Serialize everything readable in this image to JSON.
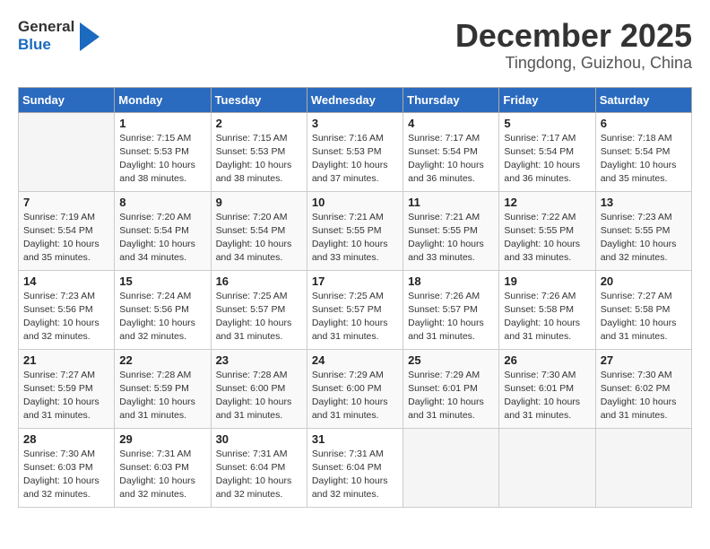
{
  "header": {
    "logo_line1": "General",
    "logo_line2": "Blue",
    "title": "December 2025",
    "subtitle": "Tingdong, Guizhou, China"
  },
  "calendar": {
    "weekdays": [
      "Sunday",
      "Monday",
      "Tuesday",
      "Wednesday",
      "Thursday",
      "Friday",
      "Saturday"
    ],
    "weeks": [
      [
        {
          "day": "",
          "sunrise": "",
          "sunset": "",
          "daylight": ""
        },
        {
          "day": "1",
          "sunrise": "Sunrise: 7:15 AM",
          "sunset": "Sunset: 5:53 PM",
          "daylight": "Daylight: 10 hours and 38 minutes."
        },
        {
          "day": "2",
          "sunrise": "Sunrise: 7:15 AM",
          "sunset": "Sunset: 5:53 PM",
          "daylight": "Daylight: 10 hours and 38 minutes."
        },
        {
          "day": "3",
          "sunrise": "Sunrise: 7:16 AM",
          "sunset": "Sunset: 5:53 PM",
          "daylight": "Daylight: 10 hours and 37 minutes."
        },
        {
          "day": "4",
          "sunrise": "Sunrise: 7:17 AM",
          "sunset": "Sunset: 5:54 PM",
          "daylight": "Daylight: 10 hours and 36 minutes."
        },
        {
          "day": "5",
          "sunrise": "Sunrise: 7:17 AM",
          "sunset": "Sunset: 5:54 PM",
          "daylight": "Daylight: 10 hours and 36 minutes."
        },
        {
          "day": "6",
          "sunrise": "Sunrise: 7:18 AM",
          "sunset": "Sunset: 5:54 PM",
          "daylight": "Daylight: 10 hours and 35 minutes."
        }
      ],
      [
        {
          "day": "7",
          "sunrise": "Sunrise: 7:19 AM",
          "sunset": "Sunset: 5:54 PM",
          "daylight": "Daylight: 10 hours and 35 minutes."
        },
        {
          "day": "8",
          "sunrise": "Sunrise: 7:20 AM",
          "sunset": "Sunset: 5:54 PM",
          "daylight": "Daylight: 10 hours and 34 minutes."
        },
        {
          "day": "9",
          "sunrise": "Sunrise: 7:20 AM",
          "sunset": "Sunset: 5:54 PM",
          "daylight": "Daylight: 10 hours and 34 minutes."
        },
        {
          "day": "10",
          "sunrise": "Sunrise: 7:21 AM",
          "sunset": "Sunset: 5:55 PM",
          "daylight": "Daylight: 10 hours and 33 minutes."
        },
        {
          "day": "11",
          "sunrise": "Sunrise: 7:21 AM",
          "sunset": "Sunset: 5:55 PM",
          "daylight": "Daylight: 10 hours and 33 minutes."
        },
        {
          "day": "12",
          "sunrise": "Sunrise: 7:22 AM",
          "sunset": "Sunset: 5:55 PM",
          "daylight": "Daylight: 10 hours and 33 minutes."
        },
        {
          "day": "13",
          "sunrise": "Sunrise: 7:23 AM",
          "sunset": "Sunset: 5:55 PM",
          "daylight": "Daylight: 10 hours and 32 minutes."
        }
      ],
      [
        {
          "day": "14",
          "sunrise": "Sunrise: 7:23 AM",
          "sunset": "Sunset: 5:56 PM",
          "daylight": "Daylight: 10 hours and 32 minutes."
        },
        {
          "day": "15",
          "sunrise": "Sunrise: 7:24 AM",
          "sunset": "Sunset: 5:56 PM",
          "daylight": "Daylight: 10 hours and 32 minutes."
        },
        {
          "day": "16",
          "sunrise": "Sunrise: 7:25 AM",
          "sunset": "Sunset: 5:57 PM",
          "daylight": "Daylight: 10 hours and 31 minutes."
        },
        {
          "day": "17",
          "sunrise": "Sunrise: 7:25 AM",
          "sunset": "Sunset: 5:57 PM",
          "daylight": "Daylight: 10 hours and 31 minutes."
        },
        {
          "day": "18",
          "sunrise": "Sunrise: 7:26 AM",
          "sunset": "Sunset: 5:57 PM",
          "daylight": "Daylight: 10 hours and 31 minutes."
        },
        {
          "day": "19",
          "sunrise": "Sunrise: 7:26 AM",
          "sunset": "Sunset: 5:58 PM",
          "daylight": "Daylight: 10 hours and 31 minutes."
        },
        {
          "day": "20",
          "sunrise": "Sunrise: 7:27 AM",
          "sunset": "Sunset: 5:58 PM",
          "daylight": "Daylight: 10 hours and 31 minutes."
        }
      ],
      [
        {
          "day": "21",
          "sunrise": "Sunrise: 7:27 AM",
          "sunset": "Sunset: 5:59 PM",
          "daylight": "Daylight: 10 hours and 31 minutes."
        },
        {
          "day": "22",
          "sunrise": "Sunrise: 7:28 AM",
          "sunset": "Sunset: 5:59 PM",
          "daylight": "Daylight: 10 hours and 31 minutes."
        },
        {
          "day": "23",
          "sunrise": "Sunrise: 7:28 AM",
          "sunset": "Sunset: 6:00 PM",
          "daylight": "Daylight: 10 hours and 31 minutes."
        },
        {
          "day": "24",
          "sunrise": "Sunrise: 7:29 AM",
          "sunset": "Sunset: 6:00 PM",
          "daylight": "Daylight: 10 hours and 31 minutes."
        },
        {
          "day": "25",
          "sunrise": "Sunrise: 7:29 AM",
          "sunset": "Sunset: 6:01 PM",
          "daylight": "Daylight: 10 hours and 31 minutes."
        },
        {
          "day": "26",
          "sunrise": "Sunrise: 7:30 AM",
          "sunset": "Sunset: 6:01 PM",
          "daylight": "Daylight: 10 hours and 31 minutes."
        },
        {
          "day": "27",
          "sunrise": "Sunrise: 7:30 AM",
          "sunset": "Sunset: 6:02 PM",
          "daylight": "Daylight: 10 hours and 31 minutes."
        }
      ],
      [
        {
          "day": "28",
          "sunrise": "Sunrise: 7:30 AM",
          "sunset": "Sunset: 6:03 PM",
          "daylight": "Daylight: 10 hours and 32 minutes."
        },
        {
          "day": "29",
          "sunrise": "Sunrise: 7:31 AM",
          "sunset": "Sunset: 6:03 PM",
          "daylight": "Daylight: 10 hours and 32 minutes."
        },
        {
          "day": "30",
          "sunrise": "Sunrise: 7:31 AM",
          "sunset": "Sunset: 6:04 PM",
          "daylight": "Daylight: 10 hours and 32 minutes."
        },
        {
          "day": "31",
          "sunrise": "Sunrise: 7:31 AM",
          "sunset": "Sunset: 6:04 PM",
          "daylight": "Daylight: 10 hours and 32 minutes."
        },
        {
          "day": "",
          "sunrise": "",
          "sunset": "",
          "daylight": ""
        },
        {
          "day": "",
          "sunrise": "",
          "sunset": "",
          "daylight": ""
        },
        {
          "day": "",
          "sunrise": "",
          "sunset": "",
          "daylight": ""
        }
      ]
    ]
  }
}
